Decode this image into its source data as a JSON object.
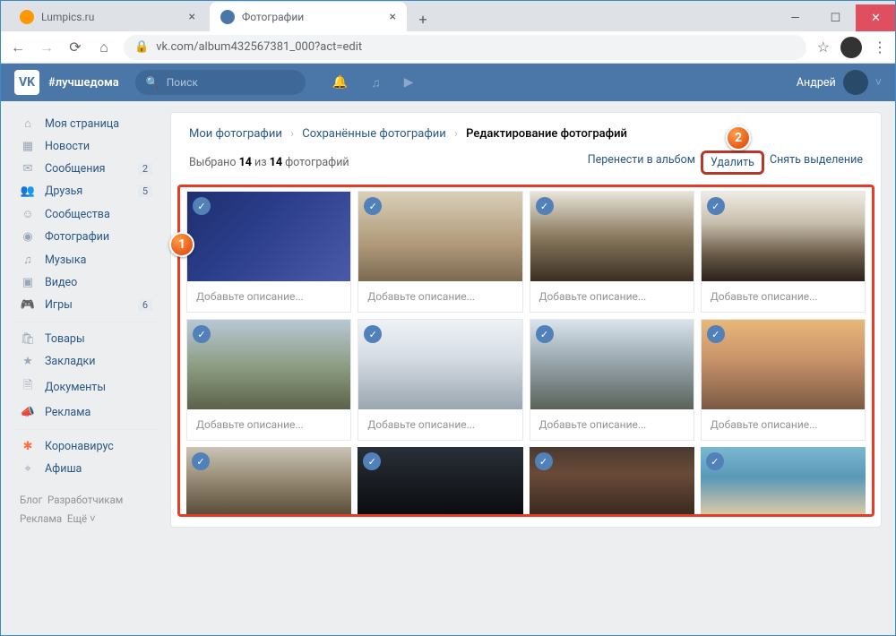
{
  "window": {
    "min": "—",
    "max": "☐",
    "close": "✕"
  },
  "tabs": [
    {
      "title": "Lumpics.ru",
      "fav_bg": "#ff9800",
      "active": false
    },
    {
      "title": "Фотографии",
      "fav_bg": "#4a76a8",
      "active": true
    }
  ],
  "browser": {
    "url": "vk.com/album432567381_000?act=edit"
  },
  "vk": {
    "hashtag": "#лучшедома",
    "search_placeholder": "Поиск",
    "user_name": "Андрей"
  },
  "sidebar": {
    "groups": [
      [
        {
          "icon": "⌂",
          "label": "Моя страница"
        },
        {
          "icon": "▦",
          "label": "Новости"
        },
        {
          "icon": "✉",
          "label": "Сообщения",
          "badge": "2"
        },
        {
          "icon": "👥",
          "label": "Друзья",
          "badge": "5"
        },
        {
          "icon": "☺",
          "label": "Сообщества"
        },
        {
          "icon": "◉",
          "label": "Фотографии"
        },
        {
          "icon": "♫",
          "label": "Музыка"
        },
        {
          "icon": "▣",
          "label": "Видео"
        },
        {
          "icon": "🎮",
          "label": "Игры",
          "badge": "6"
        }
      ],
      [
        {
          "icon": "🛍",
          "label": "Товары"
        },
        {
          "icon": "★",
          "label": "Закладки"
        },
        {
          "icon": "🗎",
          "label": "Документы"
        },
        {
          "icon": "📣",
          "label": "Реклама"
        }
      ],
      [
        {
          "icon": "✱",
          "label": "Коронавирус",
          "cls": "coro"
        },
        {
          "icon": "⌖",
          "label": "Афиша"
        }
      ]
    ],
    "footer": {
      "l1": "Блог",
      "l2": "Разработчикам",
      "l3": "Реклама",
      "l4": "Ещё ˅"
    }
  },
  "crumbs": {
    "a": "Мои фотографии",
    "b": "Сохранённые фотографии",
    "c": "Редактирование фотографий"
  },
  "selbar": {
    "pre": "Выбрано ",
    "n1": "14",
    "mid": " из ",
    "n2": "14",
    "post": " фотографий",
    "move": "Перенести в альбом",
    "del": "Удалить",
    "clear": "Снять выделение"
  },
  "desc_placeholder": "Добавьте описание...",
  "photos": [
    {
      "bg": "linear-gradient(135deg,#1f2e6e,#2a3d8a 40%,#4a5aa8)",
      "row": 1
    },
    {
      "bg": "linear-gradient(180deg,#d9cfb8,#b09878 60%,#7a6a52)",
      "row": 1
    },
    {
      "bg": "linear-gradient(180deg,#e8e4da,#8a7a5e 50%,#3a2e22)",
      "row": 1
    },
    {
      "bg": "linear-gradient(180deg,#f0ece4,#c8beac 35%,#6a5a48 70%,#2a221a)",
      "row": 1
    },
    {
      "bg": "linear-gradient(180deg,#b8c8d4,#8a9a7e 55%,#5a624a)",
      "row": 2
    },
    {
      "bg": "linear-gradient(180deg,#eef2f6,#d8dee6 40%,#9aa6b0)",
      "row": 2
    },
    {
      "bg": "linear-gradient(180deg,#dae4ec,#9aa8b0 45%,#5a6258)",
      "row": 2
    },
    {
      "bg": "linear-gradient(180deg,#e8b878,#c8926a 45%,#7a5a42)",
      "row": 2
    },
    {
      "bg": "linear-gradient(180deg,#cac4b6,#9a8e78 45%,#5a4e3a)",
      "row": 3
    },
    {
      "bg": "linear-gradient(180deg,#2a3038,#1a1e24 50%,#0a0c10)",
      "row": 3
    },
    {
      "bg": "linear-gradient(180deg,#4a3a30,#6a4a38 40%,#3a2a20)",
      "row": 3
    },
    {
      "bg": "linear-gradient(180deg,#7ab8d0,#5a98b8 45%,#d8c8a8)",
      "row": 3
    }
  ],
  "callouts": {
    "c1": "1",
    "c2": "2"
  }
}
